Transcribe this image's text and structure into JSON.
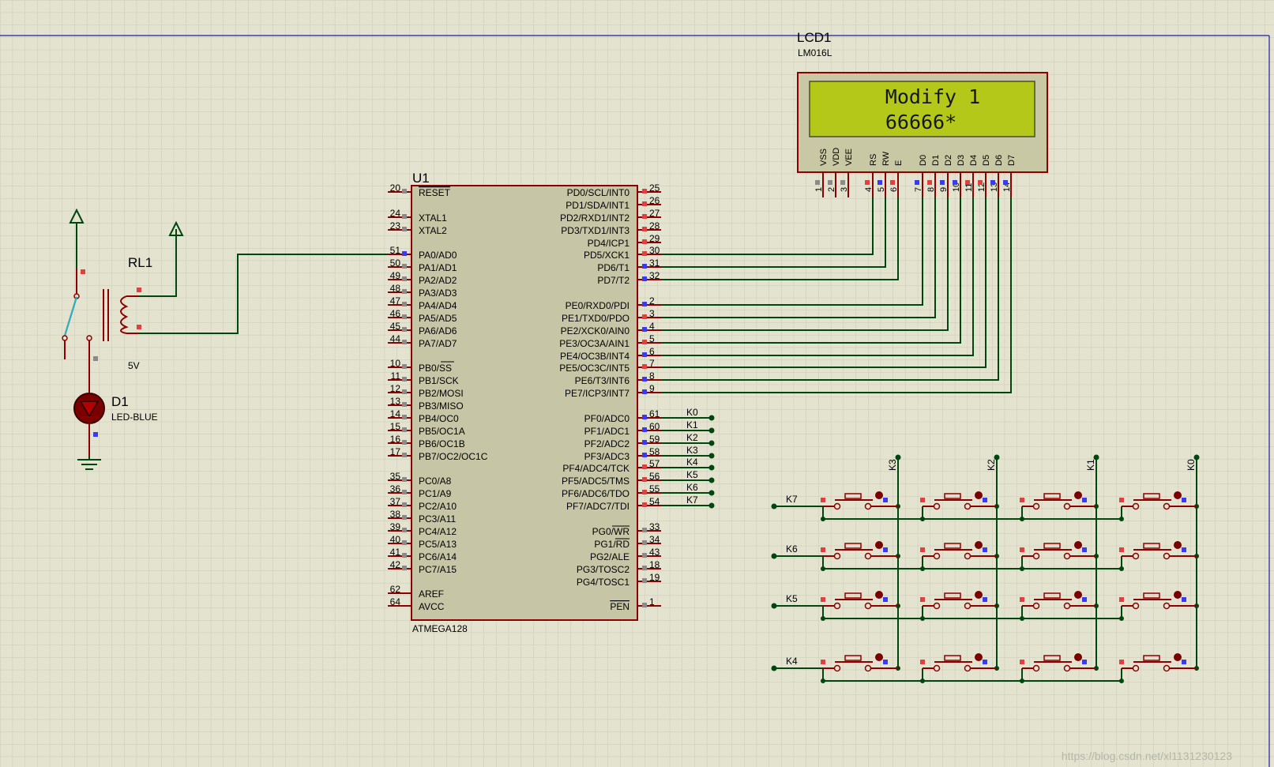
{
  "lcd": {
    "ref": "LCD1",
    "part": "LM016L",
    "line1": "Modify 1",
    "line2": "66666*",
    "pins": [
      {
        "name": "VSS",
        "num": "1"
      },
      {
        "name": "VDD",
        "num": "2"
      },
      {
        "name": "VEE",
        "num": "3"
      },
      {
        "name": "RS",
        "num": "4"
      },
      {
        "name": "RW",
        "num": "5"
      },
      {
        "name": "E",
        "num": "6"
      },
      {
        "name": "D0",
        "num": "7"
      },
      {
        "name": "D1",
        "num": "8"
      },
      {
        "name": "D2",
        "num": "9"
      },
      {
        "name": "D3",
        "num": "10"
      },
      {
        "name": "D4",
        "num": "11"
      },
      {
        "name": "D5",
        "num": "12"
      },
      {
        "name": "D6",
        "num": "13"
      },
      {
        "name": "D7",
        "num": "14"
      }
    ]
  },
  "mcu": {
    "ref": "U1",
    "part": "ATMEGA128",
    "left_pins": [
      {
        "num": "20",
        "name": "RESET",
        "overline": true
      },
      {
        "num": "24",
        "name": "XTAL1"
      },
      {
        "num": "23",
        "name": "XTAL2"
      },
      {
        "num": "51",
        "name": "PA0/AD0"
      },
      {
        "num": "50",
        "name": "PA1/AD1"
      },
      {
        "num": "49",
        "name": "PA2/AD2"
      },
      {
        "num": "48",
        "name": "PA3/AD3"
      },
      {
        "num": "47",
        "name": "PA4/AD4"
      },
      {
        "num": "46",
        "name": "PA5/AD5"
      },
      {
        "num": "45",
        "name": "PA6/AD6"
      },
      {
        "num": "44",
        "name": "PA7/AD7"
      },
      {
        "num": "10",
        "name": "PB0/SS"
      },
      {
        "num": "11",
        "name": "PB1/SCK"
      },
      {
        "num": "12",
        "name": "PB2/MOSI"
      },
      {
        "num": "13",
        "name": "PB3/MISO"
      },
      {
        "num": "14",
        "name": "PB4/OC0"
      },
      {
        "num": "15",
        "name": "PB5/OC1A"
      },
      {
        "num": "16",
        "name": "PB6/OC1B"
      },
      {
        "num": "17",
        "name": "PB7/OC2/OC1C"
      },
      {
        "num": "35",
        "name": "PC0/A8"
      },
      {
        "num": "36",
        "name": "PC1/A9"
      },
      {
        "num": "37",
        "name": "PC2/A10"
      },
      {
        "num": "38",
        "name": "PC3/A11"
      },
      {
        "num": "39",
        "name": "PC4/A12"
      },
      {
        "num": "40",
        "name": "PC5/A13"
      },
      {
        "num": "41",
        "name": "PC6/A14"
      },
      {
        "num": "42",
        "name": "PC7/A15"
      },
      {
        "num": "62",
        "name": "AREF"
      },
      {
        "num": "64",
        "name": "AVCC"
      }
    ],
    "right_pins": [
      {
        "num": "25",
        "name": "PD0/SCL/INT0"
      },
      {
        "num": "26",
        "name": "PD1/SDA/INT1"
      },
      {
        "num": "27",
        "name": "PD2/RXD1/INT2"
      },
      {
        "num": "28",
        "name": "PD3/TXD1/INT3"
      },
      {
        "num": "29",
        "name": "PD4/ICP1"
      },
      {
        "num": "30",
        "name": "PD5/XCK1"
      },
      {
        "num": "31",
        "name": "PD6/T1"
      },
      {
        "num": "32",
        "name": "PD7/T2"
      },
      {
        "num": "2",
        "name": "PE0/RXD0/PDI"
      },
      {
        "num": "3",
        "name": "PE1/TXD0/PDO"
      },
      {
        "num": "4",
        "name": "PE2/XCK0/AIN0"
      },
      {
        "num": "5",
        "name": "PE3/OC3A/AIN1"
      },
      {
        "num": "6",
        "name": "PE4/OC3B/INT4"
      },
      {
        "num": "7",
        "name": "PE5/OC3C/INT5"
      },
      {
        "num": "8",
        "name": "PE6/T3/INT6"
      },
      {
        "num": "9",
        "name": "PE7/ICP3/INT7"
      },
      {
        "num": "61",
        "name": "PF0/ADC0"
      },
      {
        "num": "60",
        "name": "PF1/ADC1"
      },
      {
        "num": "59",
        "name": "PF2/ADC2"
      },
      {
        "num": "58",
        "name": "PF3/ADC3"
      },
      {
        "num": "57",
        "name": "PF4/ADC4/TCK"
      },
      {
        "num": "56",
        "name": "PF5/ADC5/TMS"
      },
      {
        "num": "55",
        "name": "PF6/ADC6/TDO"
      },
      {
        "num": "54",
        "name": "PF7/ADC7/TDI"
      },
      {
        "num": "33",
        "name": "PG0/WR",
        "ov": "WR"
      },
      {
        "num": "34",
        "name": "PG1/RD",
        "ov": "RD"
      },
      {
        "num": "43",
        "name": "PG2/ALE"
      },
      {
        "num": "18",
        "name": "PG3/TOSC2"
      },
      {
        "num": "19",
        "name": "PG4/TOSC1"
      },
      {
        "num": "1",
        "name": "PEN",
        "overline": true
      }
    ],
    "net_labels": [
      "K0",
      "K1",
      "K2",
      "K3",
      "K4",
      "K5",
      "K6",
      "K7"
    ]
  },
  "relay": {
    "ref": "RL1",
    "voltage": "5V"
  },
  "led": {
    "ref": "D1",
    "part": "LED-BLUE"
  },
  "keypad": {
    "column_labels": [
      "K3",
      "K2",
      "K1",
      "K0"
    ],
    "row_labels": [
      "K7",
      "K6",
      "K5",
      "K4"
    ]
  },
  "watermark": "https://blog.csdn.net/xl1131230123"
}
